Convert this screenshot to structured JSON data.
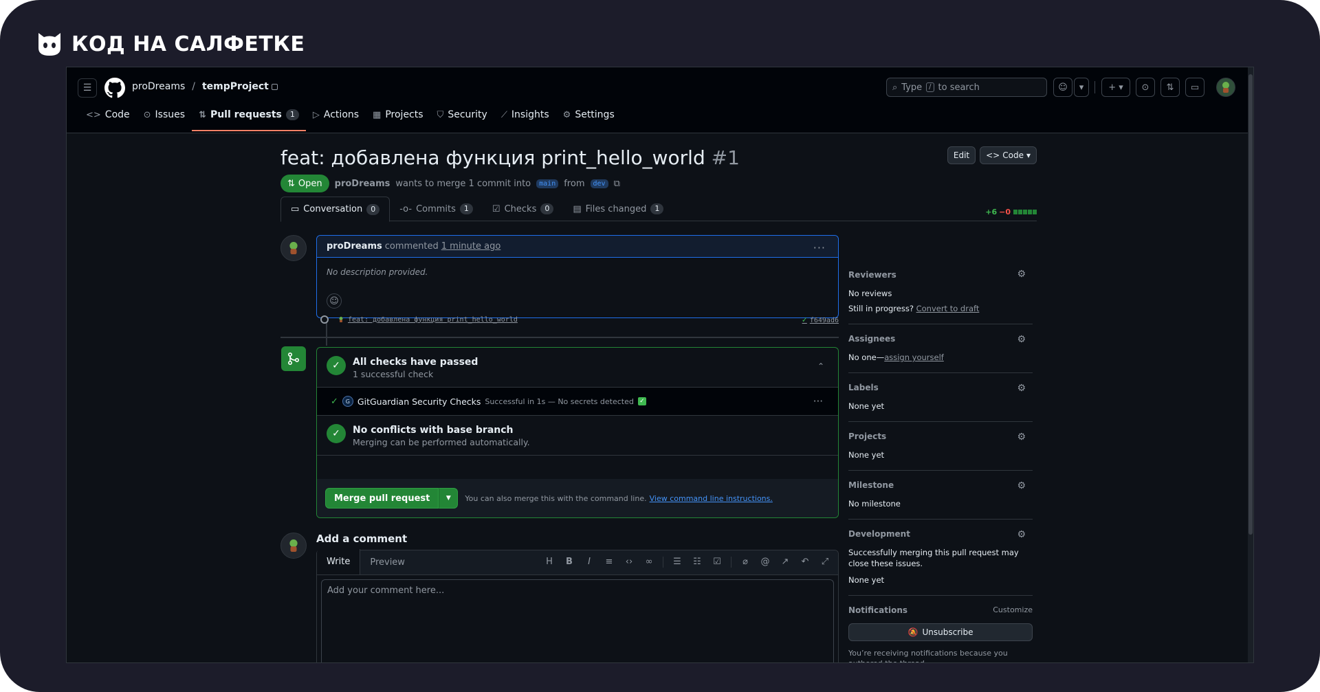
{
  "brand": {
    "text": "КОД НА САЛФЕТКЕ"
  },
  "header": {
    "owner": "proDreams",
    "separator": "/",
    "repo": "tempProject",
    "search_prefix": "Type",
    "search_key": "/",
    "search_suffix": "to search"
  },
  "repo_tabs": [
    {
      "label": "Code",
      "icon": "code-icon"
    },
    {
      "label": "Issues",
      "icon": "issue-icon"
    },
    {
      "label": "Pull requests",
      "icon": "pull-request-icon",
      "count": "1"
    },
    {
      "label": "Actions",
      "icon": "play-icon"
    },
    {
      "label": "Projects",
      "icon": "table-icon"
    },
    {
      "label": "Security",
      "icon": "shield-icon"
    },
    {
      "label": "Insights",
      "icon": "graph-icon"
    },
    {
      "label": "Settings",
      "icon": "gear-icon"
    }
  ],
  "pr": {
    "title": "feat: добавлена функция print_hello_world",
    "number": "#1",
    "edit_label": "Edit",
    "code_label": "Code",
    "state": "Open",
    "author": "proDreams",
    "merge_text": "wants to merge 1 commit into",
    "base_branch": "main",
    "from_text": "from",
    "head_branch": "dev"
  },
  "pr_tabs": [
    {
      "label": "Conversation",
      "count": "0"
    },
    {
      "label": "Commits",
      "count": "1"
    },
    {
      "label": "Checks",
      "count": "0"
    },
    {
      "label": "Files changed",
      "count": "1"
    }
  ],
  "diffstat": {
    "additions": "+6",
    "deletions": "−0"
  },
  "comment": {
    "author": "proDreams",
    "action": "commented",
    "time": "1 minute ago",
    "body": "No description provided."
  },
  "commit": {
    "message": "feat: добавлена функция print_hello_world",
    "sha": "f649ad6"
  },
  "checks": {
    "title": "All checks have passed",
    "subtitle": "1 successful check",
    "check_name": "GitGuardian Security Checks",
    "check_desc": "Successful in 1s — No secrets detected",
    "conflicts_title": "No conflicts with base branch",
    "conflicts_sub": "Merging can be performed automatically.",
    "merge_label": "Merge pull request",
    "cli_text": "You can also merge this with the command line.",
    "cli_link": "View command line instructions."
  },
  "add_comment": {
    "title": "Add a comment",
    "write": "Write",
    "preview": "Preview",
    "placeholder": "Add your comment here..."
  },
  "sidebar": {
    "reviewers_title": "Reviewers",
    "reviewers_value": "No reviews",
    "progress_text": "Still in progress?",
    "convert_link": "Convert to draft",
    "assignees_title": "Assignees",
    "assignees_value": "No one—",
    "assign_link": "assign yourself",
    "labels_title": "Labels",
    "labels_value": "None yet",
    "projects_title": "Projects",
    "projects_value": "None yet",
    "milestone_title": "Milestone",
    "milestone_value": "No milestone",
    "development_title": "Development",
    "development_text": "Successfully merging this pull request may close these issues.",
    "development_value": "None yet",
    "notifications_title": "Notifications",
    "customize": "Customize",
    "unsubscribe": "Unsubscribe",
    "notif_reason": "You’re receiving notifications because you authored the thread."
  }
}
